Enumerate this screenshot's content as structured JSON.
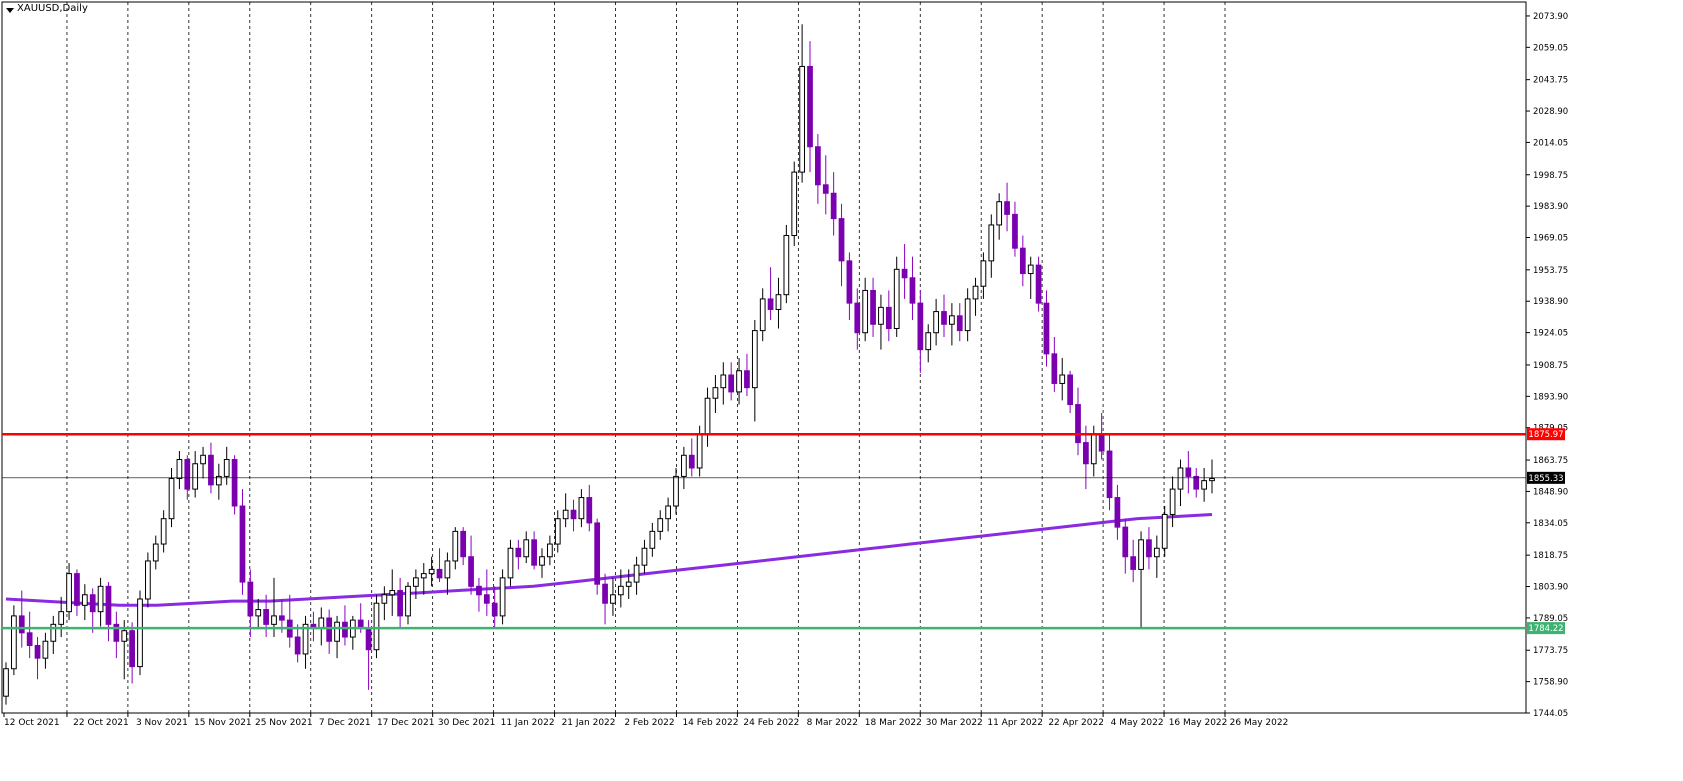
{
  "symbol_title": "XAUUSD,Daily",
  "colors": {
    "bull_body": "#ffffff",
    "bear_body": "#7a00b0",
    "wick": "#000000",
    "bear_wick": "#8a00c0",
    "ma": "#8a2be2",
    "resistance": "#ff0000",
    "support": "#3cb371",
    "current": "#000000",
    "grid_v": "#000000"
  },
  "chart_data": {
    "type": "candlestick",
    "title": "XAUUSD,Daily",
    "ylim": [
      1744.05,
      2080.5
    ],
    "y_ticks": [
      "2073.90",
      "2059.05",
      "2043.75",
      "2028.90",
      "2014.05",
      "1998.75",
      "1983.90",
      "1969.05",
      "1953.75",
      "1938.90",
      "1924.05",
      "1908.75",
      "1893.90",
      "1879.05",
      "1863.75",
      "1848.90",
      "1834.05",
      "1818.75",
      "1803.90",
      "1789.05",
      "1773.75",
      "1758.90",
      "1744.05"
    ],
    "x_ticks": [
      "12 Oct 2021",
      "22 Oct 2021",
      "3 Nov 2021",
      "15 Nov 2021",
      "25 Nov 2021",
      "7 Dec 2021",
      "17 Dec 2021",
      "30 Dec 2021",
      "11 Jan 2022",
      "21 Jan 2022",
      "2 Feb 2022",
      "14 Feb 2022",
      "24 Feb 2022",
      "8 Mar 2022",
      "18 Mar 2022",
      "30 Mar 2022",
      "11 Apr 2022",
      "22 Apr 2022",
      "4 May 2022",
      "16 May 2022",
      "26 May 2022"
    ],
    "horizontal_levels": [
      {
        "label": "1875.97",
        "value": 1875.97,
        "color": "#ff0000"
      },
      {
        "label": "1784.22",
        "value": 1784.22,
        "color": "#3cb371"
      },
      {
        "label": "1855.33",
        "value": 1855.33,
        "color": "#000000"
      }
    ],
    "grid": "vertical dashed at x ticks",
    "candles": [
      [
        1752,
        1768,
        1748,
        1765
      ],
      [
        1765,
        1795,
        1762,
        1790
      ],
      [
        1790,
        1802,
        1775,
        1782
      ],
      [
        1782,
        1792,
        1770,
        1776
      ],
      [
        1776,
        1780,
        1760,
        1770
      ],
      [
        1770,
        1782,
        1765,
        1778
      ],
      [
        1778,
        1790,
        1772,
        1786
      ],
      [
        1786,
        1799,
        1780,
        1792
      ],
      [
        1792,
        1815,
        1788,
        1810
      ],
      [
        1810,
        1812,
        1790,
        1795
      ],
      [
        1795,
        1805,
        1788,
        1800
      ],
      [
        1800,
        1803,
        1782,
        1792
      ],
      [
        1792,
        1808,
        1785,
        1804
      ],
      [
        1804,
        1806,
        1778,
        1786
      ],
      [
        1786,
        1792,
        1770,
        1778
      ],
      [
        1778,
        1788,
        1760,
        1783
      ],
      [
        1783,
        1787,
        1758,
        1766
      ],
      [
        1766,
        1802,
        1762,
        1798
      ],
      [
        1798,
        1820,
        1794,
        1816
      ],
      [
        1816,
        1828,
        1812,
        1824
      ],
      [
        1824,
        1840,
        1820,
        1836
      ],
      [
        1836,
        1860,
        1832,
        1855
      ],
      [
        1855,
        1868,
        1850,
        1864
      ],
      [
        1864,
        1866,
        1845,
        1850
      ],
      [
        1850,
        1868,
        1846,
        1862
      ],
      [
        1862,
        1870,
        1855,
        1866
      ],
      [
        1866,
        1872,
        1848,
        1852
      ],
      [
        1852,
        1862,
        1845,
        1856
      ],
      [
        1856,
        1870,
        1852,
        1864
      ],
      [
        1864,
        1866,
        1838,
        1842
      ],
      [
        1842,
        1850,
        1800,
        1806
      ],
      [
        1806,
        1812,
        1780,
        1790
      ],
      [
        1790,
        1798,
        1784,
        1793
      ],
      [
        1793,
        1800,
        1780,
        1786
      ],
      [
        1786,
        1808,
        1780,
        1790
      ],
      [
        1790,
        1798,
        1782,
        1788
      ],
      [
        1788,
        1800,
        1775,
        1780
      ],
      [
        1780,
        1786,
        1768,
        1772
      ],
      [
        1772,
        1790,
        1765,
        1786
      ],
      [
        1786,
        1792,
        1778,
        1784
      ],
      [
        1784,
        1794,
        1776,
        1789
      ],
      [
        1789,
        1793,
        1772,
        1778
      ],
      [
        1778,
        1790,
        1770,
        1787
      ],
      [
        1787,
        1795,
        1776,
        1780
      ],
      [
        1780,
        1790,
        1774,
        1788
      ],
      [
        1788,
        1796,
        1782,
        1784
      ],
      [
        1784,
        1788,
        1755,
        1774
      ],
      [
        1774,
        1800,
        1770,
        1796
      ],
      [
        1796,
        1804,
        1788,
        1800
      ],
      [
        1800,
        1812,
        1790,
        1802
      ],
      [
        1802,
        1808,
        1784,
        1790
      ],
      [
        1790,
        1806,
        1786,
        1804
      ],
      [
        1804,
        1812,
        1798,
        1808
      ],
      [
        1808,
        1815,
        1800,
        1810
      ],
      [
        1810,
        1818,
        1804,
        1812
      ],
      [
        1812,
        1822,
        1806,
        1808
      ],
      [
        1808,
        1820,
        1800,
        1816
      ],
      [
        1816,
        1832,
        1812,
        1830
      ],
      [
        1830,
        1832,
        1814,
        1818
      ],
      [
        1818,
        1828,
        1800,
        1804
      ],
      [
        1804,
        1808,
        1792,
        1800
      ],
      [
        1800,
        1812,
        1790,
        1796
      ],
      [
        1796,
        1804,
        1784,
        1790
      ],
      [
        1790,
        1812,
        1786,
        1808
      ],
      [
        1808,
        1826,
        1804,
        1822
      ],
      [
        1822,
        1826,
        1812,
        1818
      ],
      [
        1818,
        1830,
        1815,
        1826
      ],
      [
        1826,
        1830,
        1812,
        1814
      ],
      [
        1814,
        1822,
        1808,
        1818
      ],
      [
        1818,
        1828,
        1814,
        1824
      ],
      [
        1824,
        1840,
        1820,
        1836
      ],
      [
        1836,
        1848,
        1832,
        1840
      ],
      [
        1840,
        1845,
        1830,
        1836
      ],
      [
        1836,
        1850,
        1832,
        1846
      ],
      [
        1846,
        1852,
        1830,
        1834
      ],
      [
        1834,
        1836,
        1800,
        1805
      ],
      [
        1805,
        1810,
        1786,
        1796
      ],
      [
        1796,
        1808,
        1790,
        1800
      ],
      [
        1800,
        1812,
        1794,
        1804
      ],
      [
        1804,
        1812,
        1798,
        1806
      ],
      [
        1806,
        1818,
        1800,
        1814
      ],
      [
        1814,
        1826,
        1810,
        1822
      ],
      [
        1822,
        1834,
        1818,
        1830
      ],
      [
        1830,
        1840,
        1826,
        1836
      ],
      [
        1836,
        1846,
        1830,
        1842
      ],
      [
        1842,
        1860,
        1838,
        1856
      ],
      [
        1856,
        1870,
        1850,
        1866
      ],
      [
        1866,
        1874,
        1856,
        1860
      ],
      [
        1860,
        1880,
        1856,
        1876
      ],
      [
        1876,
        1898,
        1870,
        1893
      ],
      [
        1893,
        1904,
        1886,
        1898
      ],
      [
        1898,
        1910,
        1890,
        1904
      ],
      [
        1904,
        1910,
        1892,
        1896
      ],
      [
        1896,
        1912,
        1890,
        1906
      ],
      [
        1906,
        1914,
        1894,
        1898
      ],
      [
        1898,
        1930,
        1882,
        1925
      ],
      [
        1925,
        1945,
        1920,
        1940
      ],
      [
        1940,
        1955,
        1930,
        1935
      ],
      [
        1935,
        1950,
        1926,
        1942
      ],
      [
        1942,
        1975,
        1938,
        1970
      ],
      [
        1970,
        2005,
        1965,
        2000
      ],
      [
        2000,
        2070,
        1995,
        2050
      ],
      [
        2050,
        2062,
        2000,
        2012
      ],
      [
        2012,
        2018,
        1985,
        1994
      ],
      [
        1994,
        2008,
        1980,
        1990
      ],
      [
        1990,
        2000,
        1970,
        1978
      ],
      [
        1978,
        1985,
        1946,
        1958
      ],
      [
        1958,
        1962,
        1930,
        1938
      ],
      [
        1938,
        1945,
        1916,
        1924
      ],
      [
        1924,
        1950,
        1920,
        1944
      ],
      [
        1944,
        1950,
        1922,
        1928
      ],
      [
        1928,
        1942,
        1916,
        1936
      ],
      [
        1936,
        1944,
        1920,
        1926
      ],
      [
        1926,
        1960,
        1922,
        1954
      ],
      [
        1954,
        1966,
        1940,
        1950
      ],
      [
        1950,
        1960,
        1930,
        1938
      ],
      [
        1938,
        1944,
        1905,
        1916
      ],
      [
        1916,
        1928,
        1910,
        1924
      ],
      [
        1924,
        1940,
        1918,
        1934
      ],
      [
        1934,
        1942,
        1922,
        1928
      ],
      [
        1928,
        1938,
        1918,
        1932
      ],
      [
        1932,
        1938,
        1920,
        1925
      ],
      [
        1925,
        1945,
        1920,
        1940
      ],
      [
        1940,
        1950,
        1932,
        1946
      ],
      [
        1946,
        1962,
        1940,
        1958
      ],
      [
        1958,
        1980,
        1950,
        1975
      ],
      [
        1975,
        1990,
        1968,
        1986
      ],
      [
        1986,
        1995,
        1972,
        1980
      ],
      [
        1980,
        1986,
        1960,
        1964
      ],
      [
        1964,
        1970,
        1946,
        1952
      ],
      [
        1952,
        1960,
        1940,
        1956
      ],
      [
        1956,
        1960,
        1934,
        1938
      ],
      [
        1938,
        1944,
        1908,
        1914
      ],
      [
        1914,
        1922,
        1896,
        1900
      ],
      [
        1900,
        1912,
        1892,
        1904
      ],
      [
        1904,
        1906,
        1886,
        1890
      ],
      [
        1890,
        1898,
        1866,
        1872
      ],
      [
        1872,
        1880,
        1850,
        1862
      ],
      [
        1862,
        1880,
        1856,
        1876
      ],
      [
        1876,
        1886,
        1864,
        1868
      ],
      [
        1868,
        1876,
        1840,
        1846
      ],
      [
        1846,
        1852,
        1826,
        1832
      ],
      [
        1832,
        1836,
        1810,
        1818
      ],
      [
        1818,
        1826,
        1806,
        1812
      ],
      [
        1812,
        1830,
        1784,
        1826
      ],
      [
        1826,
        1832,
        1812,
        1818
      ],
      [
        1818,
        1828,
        1808,
        1822
      ],
      [
        1822,
        1842,
        1818,
        1838
      ],
      [
        1838,
        1856,
        1832,
        1850
      ],
      [
        1850,
        1864,
        1842,
        1860
      ],
      [
        1860,
        1868,
        1848,
        1856
      ],
      [
        1856,
        1860,
        1846,
        1850
      ],
      [
        1850,
        1860,
        1844,
        1854
      ],
      [
        1854,
        1864,
        1848,
        1855
      ]
    ],
    "ma_values": [
      1798,
      1797,
      1796,
      1795,
      1795,
      1796,
      1797,
      1797,
      1798,
      1799,
      1800,
      1801,
      1802,
      1803,
      1804,
      1806,
      1808,
      1810,
      1812,
      1814,
      1816,
      1818,
      1820,
      1822,
      1824,
      1826,
      1828,
      1830,
      1832,
      1834,
      1836,
      1837,
      1838
    ]
  }
}
